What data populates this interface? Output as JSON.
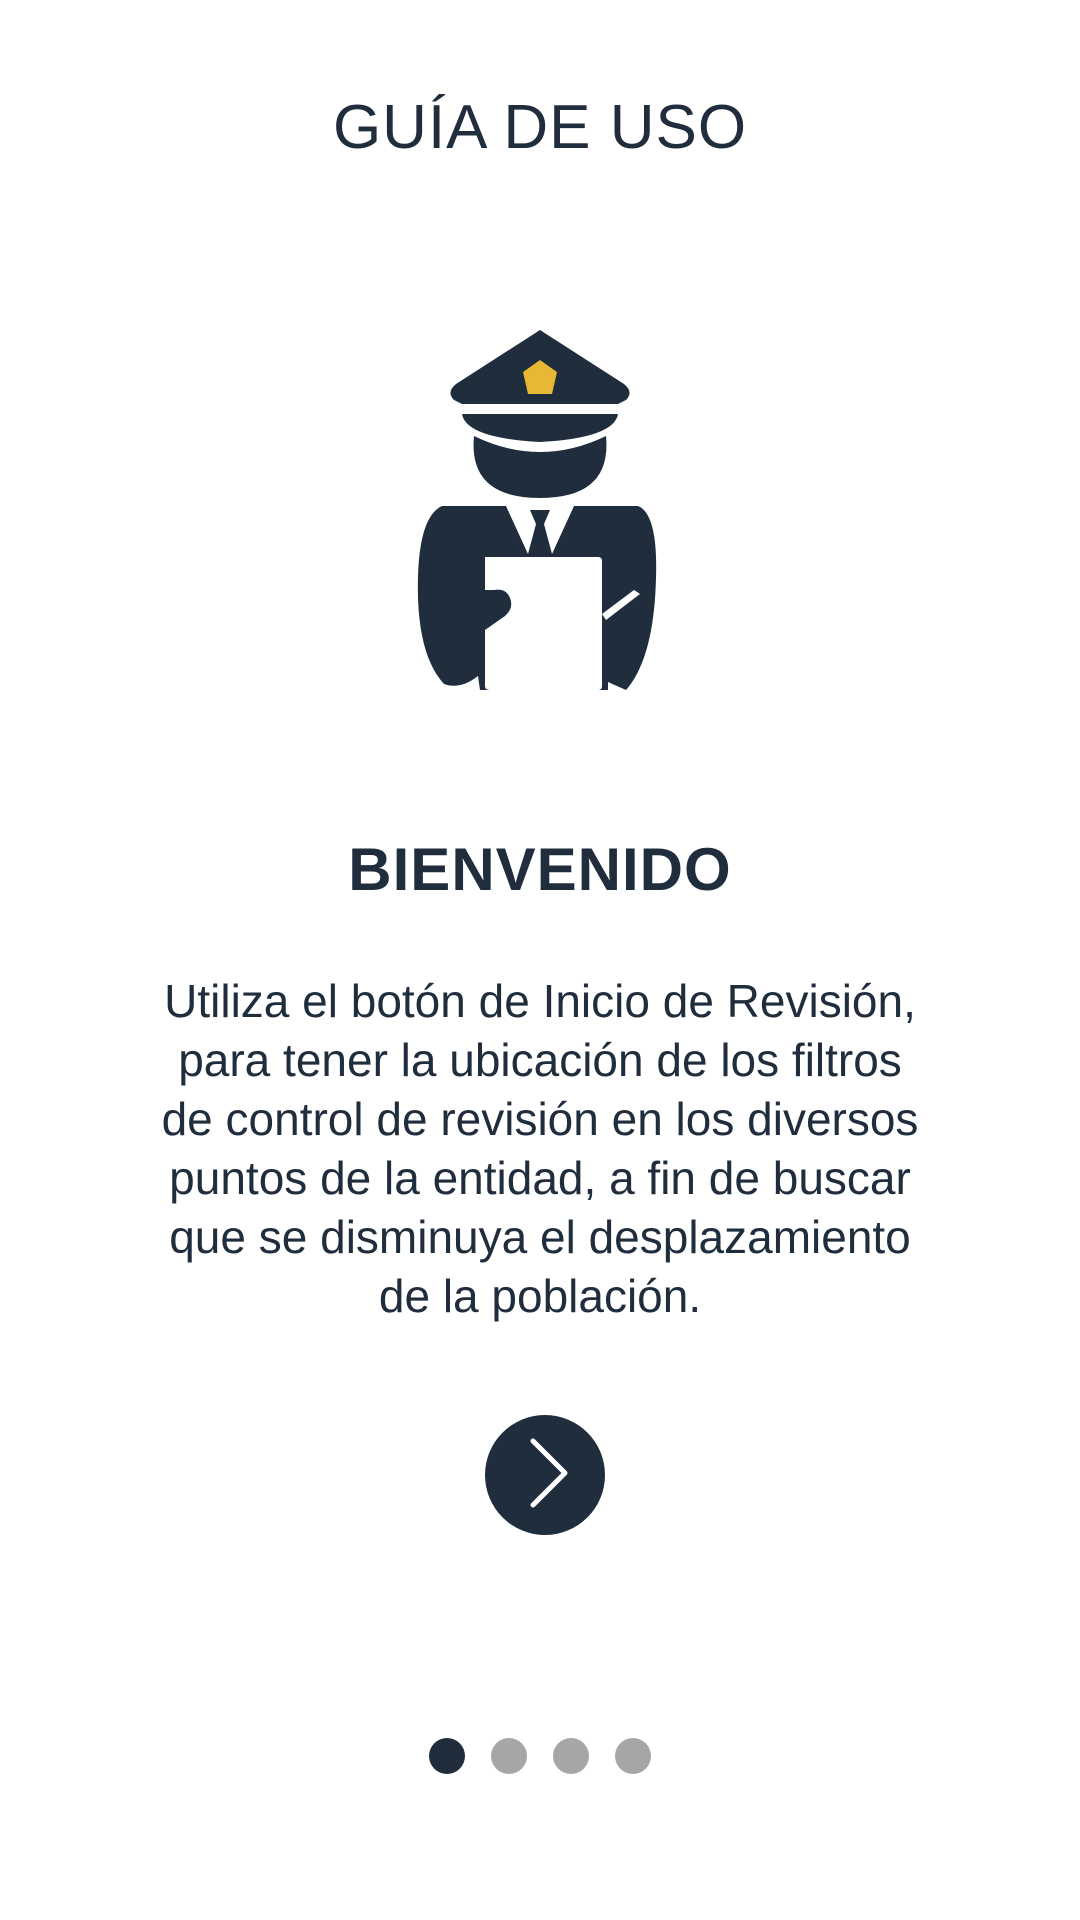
{
  "header": {
    "title": "GUÍA DE USO"
  },
  "illustration": {
    "icon": "officer-with-clipboard-icon"
  },
  "content": {
    "heading": "BIENVENIDO",
    "description": "Utiliza el botón de Inicio de Revisión,\npara tener  la ubicación de los filtros\nde control de revisión en los diversos\npuntos  de la entidad, a fin de buscar\nque se disminuya el desplazamiento\nde la población."
  },
  "navigation": {
    "next_icon": "chevron-right-icon",
    "page_count": 4,
    "current_page": 1
  },
  "colors": {
    "primary": "#1f2d3d",
    "badge": "#e8b834",
    "dot_active": "#1f2d3d",
    "dot_inactive": "#a6a6a6",
    "background": "#ffffff"
  }
}
